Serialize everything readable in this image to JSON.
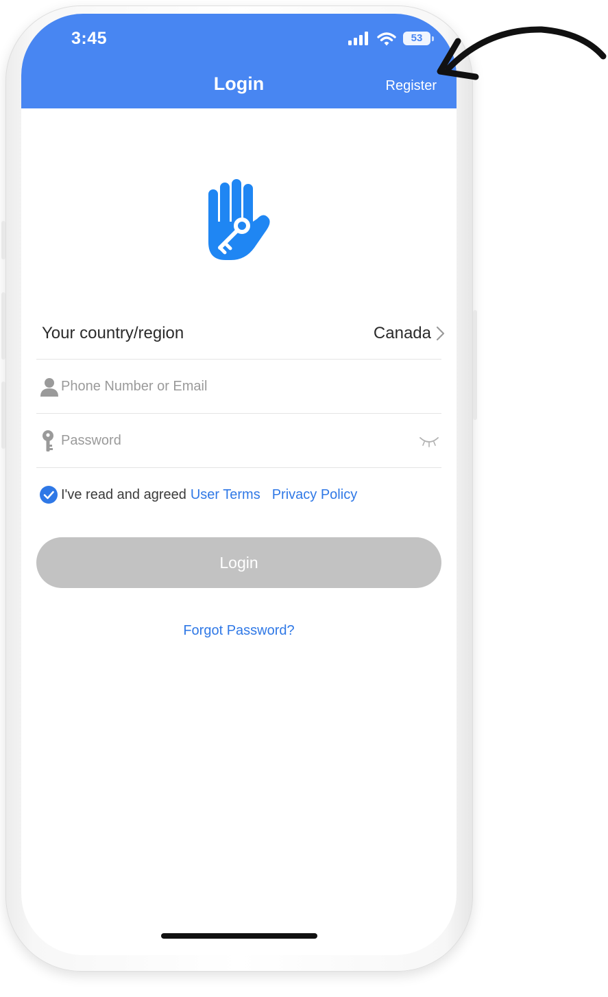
{
  "status_bar": {
    "time": "3:45",
    "battery": "53",
    "icons": [
      "signal-icon",
      "wifi-icon",
      "battery-icon"
    ]
  },
  "nav": {
    "title": "Login",
    "register_label": "Register"
  },
  "logo": {
    "icon": "hand-key-icon",
    "color": "#1f86f3"
  },
  "form": {
    "country_label": "Your country/region",
    "country_value": "Canada",
    "phone_placeholder": "Phone Number or Email",
    "phone_value": "",
    "password_placeholder": "Password",
    "password_value": ""
  },
  "agreement": {
    "checked": true,
    "text": "I've read and agreed",
    "terms_link": "User Terms",
    "privacy_link": "Privacy Policy"
  },
  "login_button_label": "Login",
  "forgot_password_label": "Forgot Password?",
  "colors": {
    "header": "#4886f2",
    "link": "#2f78e6",
    "button_disabled": "#c2c2c2"
  }
}
